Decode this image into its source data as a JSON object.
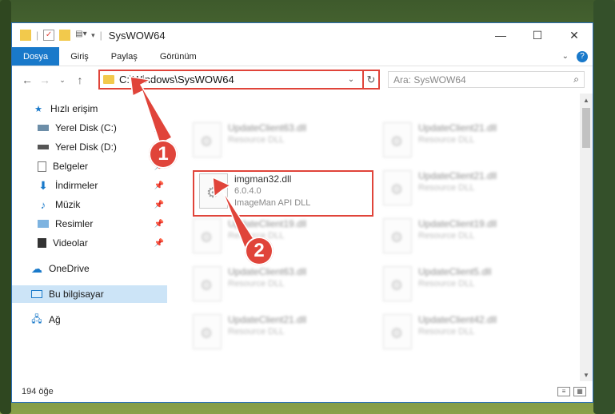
{
  "window": {
    "title": "SysWOW64",
    "controls": {
      "minimize": "—",
      "maximize": "☐",
      "close": "✕"
    }
  },
  "ribbon": {
    "tabs": [
      "Dosya",
      "Giriş",
      "Paylaş",
      "Görünüm"
    ],
    "active_tab": "Dosya"
  },
  "address": {
    "path": "C:\\Windows\\SysWOW64",
    "search_placeholder": "Ara: SysWOW64"
  },
  "sidebar": {
    "items": [
      {
        "label": "Hızlı erişim",
        "icon": "star-icon"
      },
      {
        "label": "Yerel Disk (C:)",
        "icon": "drive-icon",
        "pinned": true
      },
      {
        "label": "Yerel Disk (D:)",
        "icon": "drive-icon"
      },
      {
        "label": "Belgeler",
        "icon": "documents-icon",
        "pinned": true
      },
      {
        "label": "İndirmeler",
        "icon": "download-icon",
        "pinned": true
      },
      {
        "label": "Müzik",
        "icon": "music-icon",
        "pinned": true
      },
      {
        "label": "Resimler",
        "icon": "pictures-icon",
        "pinned": true
      },
      {
        "label": "Videolar",
        "icon": "videos-icon",
        "pinned": true
      },
      {
        "label": "OneDrive",
        "icon": "cloud-icon"
      },
      {
        "label": "Bu bilgisayar",
        "icon": "computer-icon",
        "selected": true
      },
      {
        "label": "Ağ",
        "icon": "network-icon"
      }
    ]
  },
  "files": {
    "left": [
      {
        "name": "UpdateClient63.dll",
        "sub": "Resource DLL"
      },
      {
        "name": "imgman32.dll",
        "sub": "6.0.4.0",
        "sub2": "ImageMan API DLL"
      },
      {
        "name": "UpdateClient19.dll",
        "sub": "Resource DLL"
      },
      {
        "name": "UpdateClient63.dll",
        "sub": "Resource DLL"
      },
      {
        "name": "UpdateClient21.dll",
        "sub": "Resource DLL"
      }
    ],
    "right": [
      {
        "name": "UpdateClient21.dll",
        "sub": "Resource DLL"
      },
      {
        "name": "UpdateClient21.dll",
        "sub": "Resource DLL"
      },
      {
        "name": "UpdateClient19.dll",
        "sub": "Resource DLL"
      },
      {
        "name": "UpdateClient5.dll",
        "sub": "Resource DLL"
      },
      {
        "name": "UpdateClient42.dll",
        "sub": "Resource DLL"
      }
    ]
  },
  "status": {
    "count": "194 öğe"
  },
  "annotations": {
    "step1": "1",
    "step2": "2"
  },
  "colors": {
    "accent": "#1979ca",
    "highlight": "#e0443a"
  }
}
